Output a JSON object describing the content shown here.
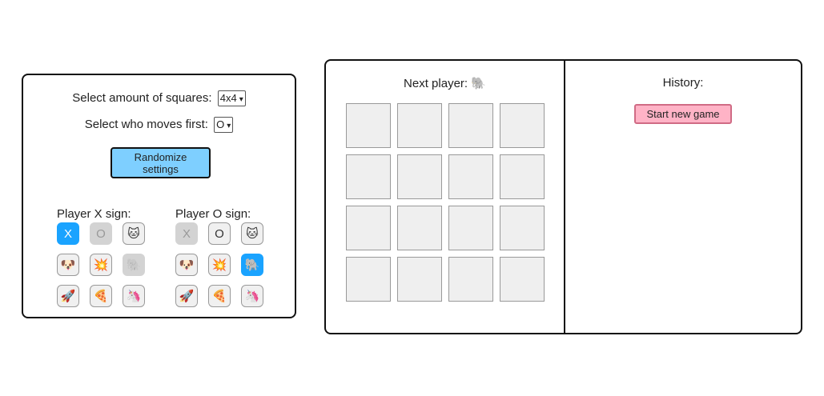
{
  "settings": {
    "squares_label": "Select amount of squares:",
    "squares_value": "4x4",
    "first_label": "Select who moves first:",
    "first_value": "O",
    "randomize_label": "Randomize settings",
    "player_x_label": "Player X sign:",
    "player_o_label": "Player O sign:",
    "signs": [
      "X",
      "O",
      "🐱",
      "🐶",
      "💥",
      "🐘",
      "🚀",
      "🍕",
      "🦄"
    ],
    "player_x": {
      "selected": "X",
      "disabled": [
        "O",
        "🐘"
      ]
    },
    "player_o": {
      "selected": "🐘",
      "disabled": [
        "X"
      ]
    }
  },
  "game": {
    "next_player_label": "Next player:",
    "next_player_sign": "🐘",
    "board_size": 4,
    "cells": [
      "",
      "",
      "",
      "",
      "",
      "",
      "",
      "",
      "",
      "",
      "",
      "",
      "",
      "",
      "",
      ""
    ]
  },
  "history": {
    "title": "History:",
    "new_game_label": "Start new game"
  },
  "colors": {
    "selected": "#1aa3ff",
    "randomize_bg": "#7ecfff",
    "new_game_bg": "#ffb3c6",
    "disabled": "#d3d3d3",
    "cell_bg": "#efefef"
  }
}
